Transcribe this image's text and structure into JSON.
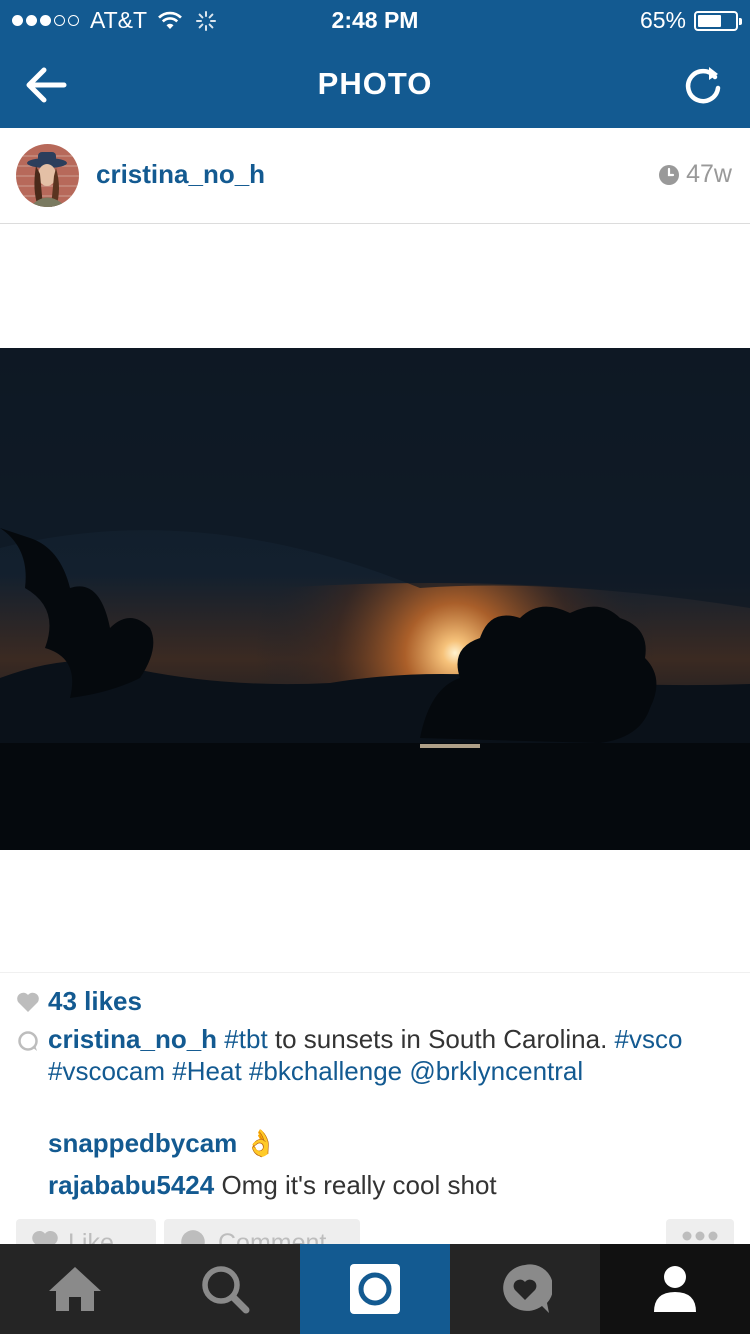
{
  "status_bar": {
    "carrier": "AT&T",
    "time": "2:48 PM",
    "battery_percent": "65%",
    "battery_level": 0.65
  },
  "nav": {
    "title": "PHOTO",
    "back_icon": "back-arrow-icon",
    "refresh_icon": "refresh-icon"
  },
  "post": {
    "username": "cristina_no_h",
    "time_ago": "47w",
    "likes": "43 likes",
    "caption": {
      "user": "cristina_no_h",
      "text_parts": [
        {
          "kind": "tag",
          "text": "#tbt"
        },
        {
          "kind": "plain",
          "text": " to sunsets in South Carolina. "
        },
        {
          "kind": "tag",
          "text": "#vsco"
        },
        {
          "kind": "plain",
          "text": " "
        },
        {
          "kind": "tag",
          "text": "#vscocam"
        },
        {
          "kind": "plain",
          "text": "  "
        },
        {
          "kind": "tag",
          "text": "#Heat"
        },
        {
          "kind": "plain",
          "text": " "
        },
        {
          "kind": "tag",
          "text": "#bkchallenge"
        },
        {
          "kind": "plain",
          "text": " "
        },
        {
          "kind": "tag",
          "text": "@brklyncentral"
        }
      ]
    },
    "comments": [
      {
        "user": "snappedbycam",
        "text": "👌"
      },
      {
        "user": "rajababu5424",
        "text": "Omg it's really cool shot"
      }
    ]
  },
  "actions": {
    "like_label": "Like",
    "comment_label": "Comment"
  },
  "tabs": [
    {
      "icon": "home-icon"
    },
    {
      "icon": "search-icon"
    },
    {
      "icon": "camera-icon",
      "active": true
    },
    {
      "icon": "activity-heart-icon"
    },
    {
      "icon": "profile-icon"
    }
  ],
  "colors": {
    "brand_blue": "#135a91",
    "tabbar": "#252525",
    "muted": "#999999"
  }
}
